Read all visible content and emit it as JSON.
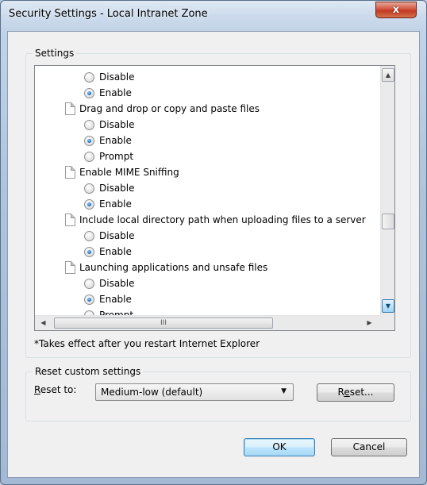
{
  "window": {
    "title": "Security Settings - Local Intranet Zone",
    "close_label": "x"
  },
  "settings_group": {
    "label": "Settings",
    "rows": [
      {
        "type": "option",
        "label": "Disable",
        "checked": false
      },
      {
        "type": "option",
        "label": "Enable",
        "checked": true
      },
      {
        "type": "setting",
        "label": "Drag and drop or copy and paste files"
      },
      {
        "type": "option",
        "label": "Disable",
        "checked": false
      },
      {
        "type": "option",
        "label": "Enable",
        "checked": true
      },
      {
        "type": "option",
        "label": "Prompt",
        "checked": false
      },
      {
        "type": "setting",
        "label": "Enable MIME Sniffing"
      },
      {
        "type": "option",
        "label": "Disable",
        "checked": false
      },
      {
        "type": "option",
        "label": "Enable",
        "checked": true
      },
      {
        "type": "setting",
        "label": "Include local directory path when uploading files to a server"
      },
      {
        "type": "option",
        "label": "Disable",
        "checked": false
      },
      {
        "type": "option",
        "label": "Enable",
        "checked": true
      },
      {
        "type": "setting",
        "label": "Launching applications and unsafe files"
      },
      {
        "type": "option",
        "label": "Disable",
        "checked": false
      },
      {
        "type": "option",
        "label": "Enable",
        "checked": true
      },
      {
        "type": "option",
        "label": "Prompt",
        "checked": false
      }
    ],
    "hscroll_grip": "III",
    "note": "*Takes effect after you restart Internet Explorer"
  },
  "reset_group": {
    "label": "Reset custom settings",
    "reset_to_label_prefix": "R",
    "reset_to_label_rest": "eset to:",
    "selected": "Medium-low (default)",
    "reset_button_prefix": "R",
    "reset_button_accel": "e",
    "reset_button_rest": "set..."
  },
  "buttons": {
    "ok": "OK",
    "cancel": "Cancel"
  },
  "icons": {
    "up": "arrow-up-icon",
    "down": "arrow-down-icon",
    "left": "arrow-left-icon",
    "right": "arrow-right-icon",
    "combo": "chevron-down-icon",
    "close": "close-icon",
    "setting": "document-icon"
  }
}
